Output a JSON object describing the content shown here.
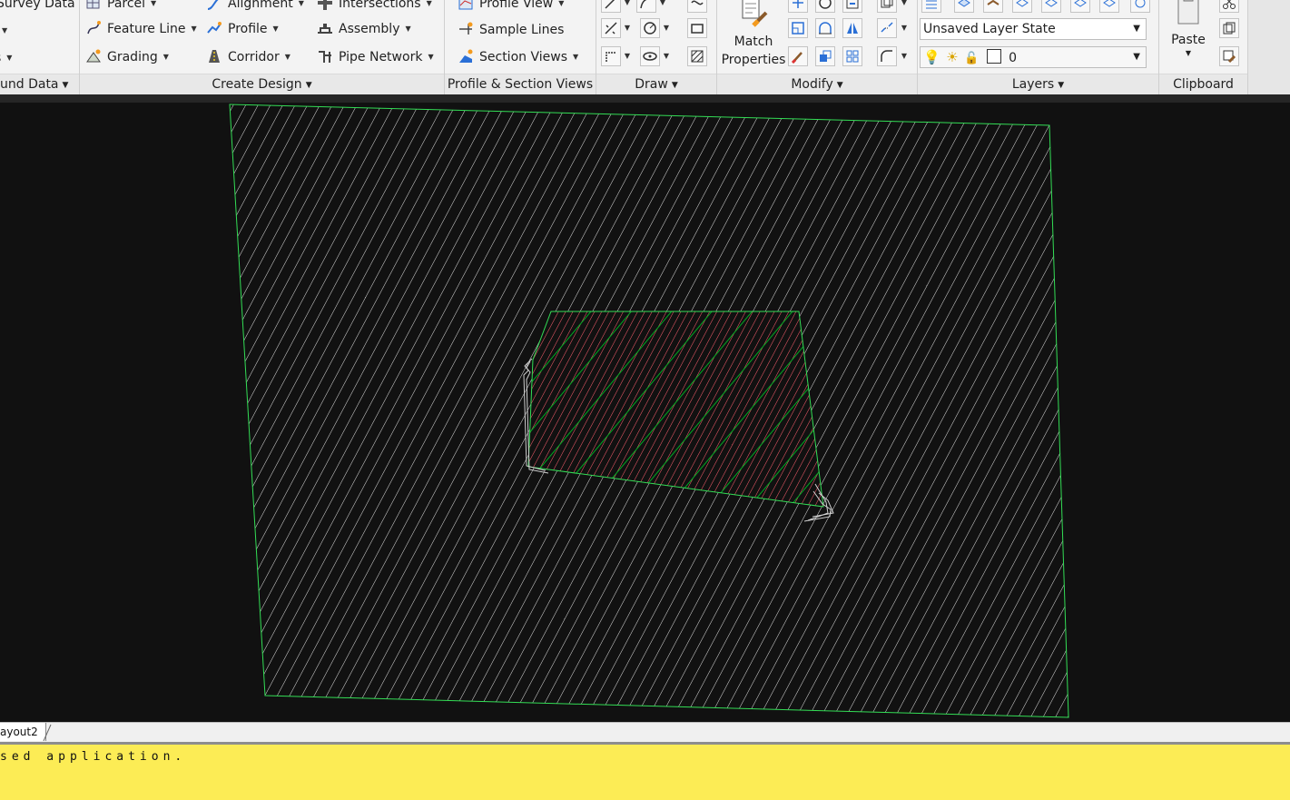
{
  "ribbon": {
    "panels": [
      {
        "label": "und Data"
      },
      {
        "label": "Create Design"
      },
      {
        "label": "Profile & Section Views"
      },
      {
        "label": "Draw"
      },
      {
        "label": "Modify"
      },
      {
        "label": "Layers"
      },
      {
        "label": "Clipboard"
      }
    ],
    "ground_data": {
      "item1": "Survey Data"
    },
    "create_design": {
      "parcel": "Parcel",
      "feature_line": "Feature Line",
      "grading": "Grading",
      "alignment": "Alignment",
      "profile": "Profile",
      "corridor": "Corridor",
      "intersections": "Intersections",
      "assembly": "Assembly",
      "pipe_network": "Pipe Network"
    },
    "profile_section": {
      "profile_view": "Profile View",
      "sample_lines": "Sample Lines",
      "section_views": "Section Views"
    },
    "modify": {
      "match_properties_line1": "Match",
      "match_properties_line2": "Properties"
    },
    "layers": {
      "layer_state": "Unsaved Layer State",
      "current_layer": "0"
    },
    "clipboard": {
      "paste": "Paste"
    }
  },
  "layout_tabs": [
    {
      "label": "ayout2"
    }
  ],
  "command_line": {
    "text": "sed application."
  },
  "colors": {
    "boundary": "#33dd55",
    "hatch": "#e0e0e0",
    "inner_red": "#ff6070",
    "inner_green": "#00aa22",
    "command_bg": "#fcec55"
  }
}
